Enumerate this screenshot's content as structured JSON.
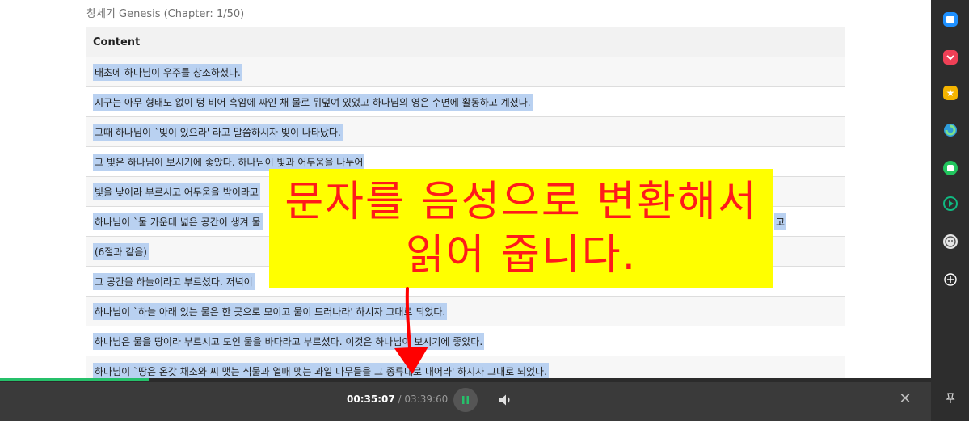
{
  "book": {
    "title": "창세기 Genesis (Chapter: 1/50)"
  },
  "table": {
    "header": "Content",
    "rows": [
      "태초에 하나님이 우주를 창조하셨다.",
      "지구는 아무 형태도 없이 텅 비어 흑암에 싸인 채 물로 뒤덮여 있었고 하나님의 영은 수면에 활동하고 계셨다.",
      "그때 하나님이 `빛이 있으라' 라고 말씀하시자 빛이 나타났다.",
      "그 빛은 하나님이 보시기에 좋았다. 하나님이 빛과 어두움을 나누어",
      "빛을 낮이라 부르시고 어두움을 밤이라고",
      "하나님이 `물 가운데 넓은 공간이 생겨 물",
      "(6절과 같음)",
      "그 공간을 하늘이라고 부르셨다. 저녁이",
      "하나님이 `하늘 아래 있는 물은 한 곳으로 모이고 물이 드러나라' 하시자 그대로 되었다.",
      "하나님은 물을 땅이라 부르시고 모인 물을 바다라고 부르셨다. 이것은 하나님이 보시기에 좋았다.",
      "하나님이 `땅은 온갖 채소와 씨 맺는 식물과 열매 맺는 과일 나무들을 그 종류대로 내어라' 하시자 그대로 되었다."
    ],
    "row6_tail": "고"
  },
  "overlay": {
    "line1": "문자를 음성으로 변환해서",
    "line2": "읽어 줍니다."
  },
  "player": {
    "current_time": "00:35:07",
    "separator": " / ",
    "total_time": "03:39:60",
    "progress": 0.16,
    "play_icon": "pause-icon",
    "volume_icon": "volume-icon",
    "close_icon": "close-icon",
    "close_glyph": "✕"
  },
  "sidebar": {
    "icons": [
      {
        "name": "sidebar-app-blue-icon",
        "color": "#1e90ff"
      },
      {
        "name": "sidebar-app-pocket-icon",
        "color": "#ef4056"
      },
      {
        "name": "sidebar-app-star-icon",
        "color": "#f5b400"
      },
      {
        "name": "sidebar-app-edge-icon",
        "color": "#2d9cdb"
      },
      {
        "name": "sidebar-app-green-icon",
        "color": "#22c55e"
      },
      {
        "name": "sidebar-app-play-icon",
        "color": "#10b981"
      },
      {
        "name": "sidebar-app-face-icon",
        "color": "#e5e5e5"
      },
      {
        "name": "sidebar-add-icon",
        "color": "#ffffff"
      }
    ],
    "bottom_icon": "pin-icon"
  },
  "colors": {
    "selection": "#b9d1f1",
    "overlay_bg": "#ffff00",
    "overlay_text": "#ff1a1a",
    "progress": "#26c06a"
  }
}
